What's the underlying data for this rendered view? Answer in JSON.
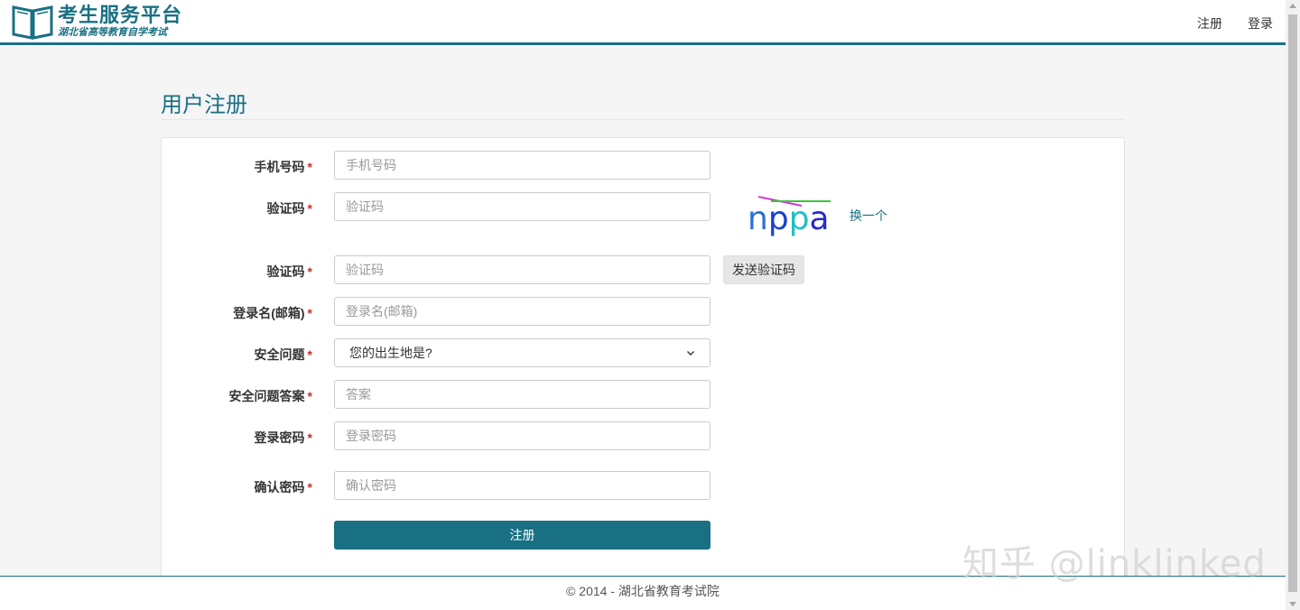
{
  "header": {
    "logo_title": "考生服务平台",
    "logo_subtitle": "湖北省高等教育自学考试",
    "nav": [
      "注册",
      "登录"
    ]
  },
  "page_title": "用户注册",
  "form": {
    "fields": [
      {
        "label": "手机号码",
        "placeholder": "手机号码"
      },
      {
        "label": "验证码",
        "placeholder": "验证码"
      },
      {
        "label": "验证码",
        "placeholder": "验证码"
      },
      {
        "label": "登录名(邮箱)",
        "placeholder": "登录名(邮箱)"
      },
      {
        "label": "安全问题",
        "value": "您的出生地是?"
      },
      {
        "label": "安全问题答案",
        "placeholder": "答案"
      },
      {
        "label": "登录密码",
        "placeholder": "登录密码"
      },
      {
        "label": "确认密码",
        "placeholder": "确认密码"
      }
    ],
    "required_mark": "*",
    "captcha_text": "nppa",
    "captcha_refresh": "换一个",
    "send_code_label": "发送验证码",
    "submit_label": "注册"
  },
  "footer": "© 2014 - 湖北省教育考试院",
  "watermark": "知乎 @linklinked",
  "colors": {
    "brand": "#1a7083",
    "required": "#c9302c"
  }
}
